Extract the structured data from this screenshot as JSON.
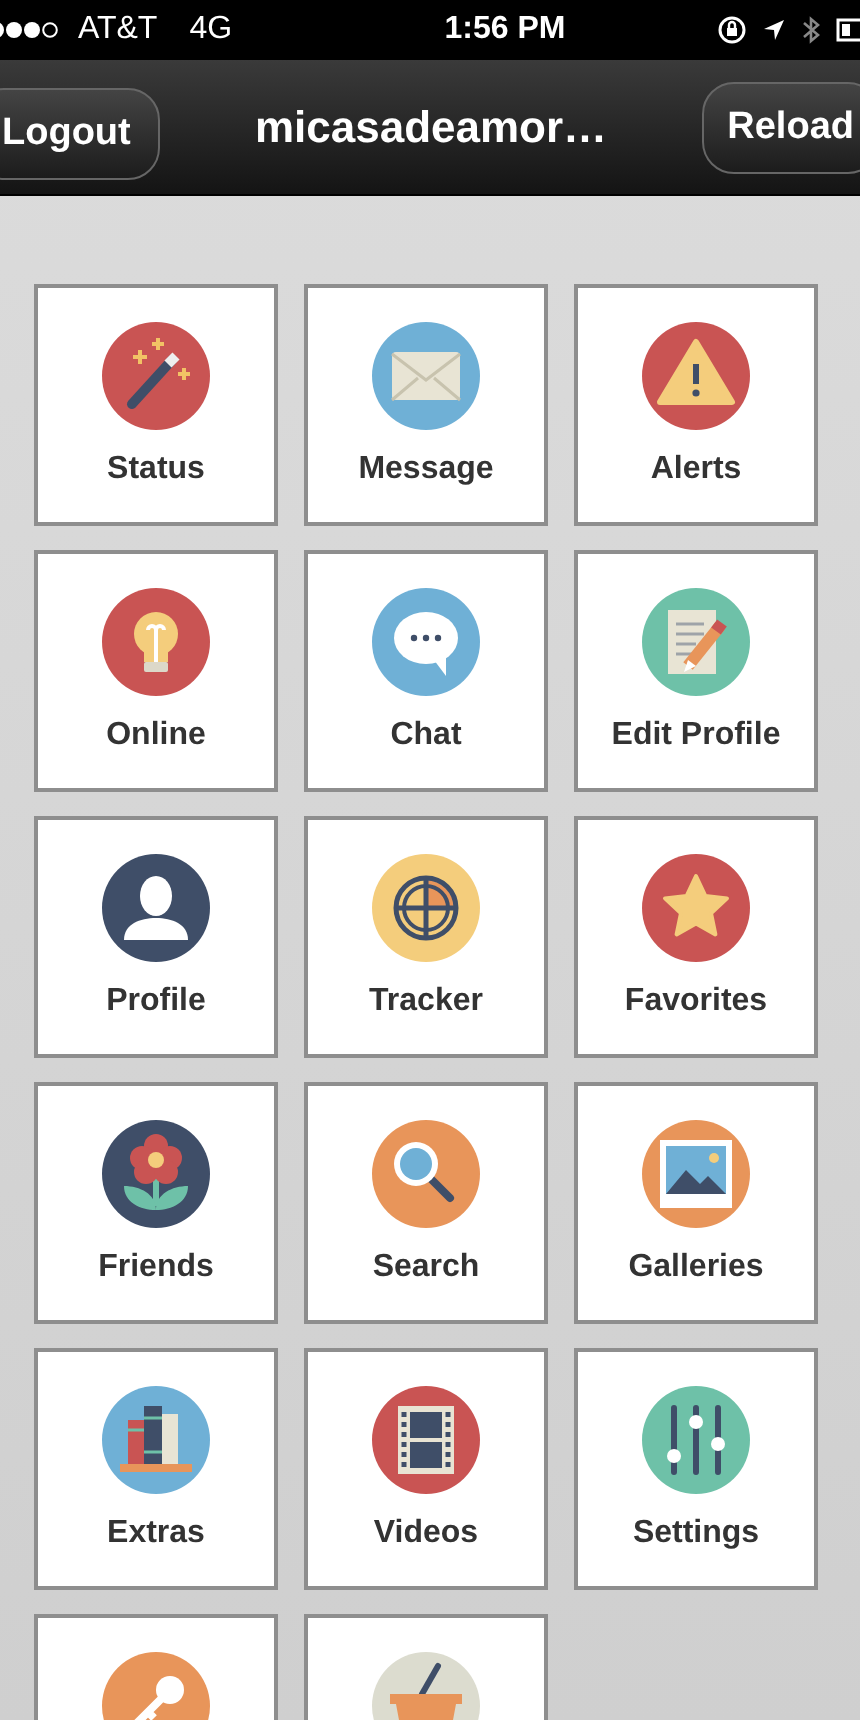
{
  "status_bar": {
    "carrier": "AT&T",
    "network": "4G",
    "time": "1:56 PM"
  },
  "nav_bar": {
    "left_button": "Logout",
    "title": "micasadeamor…",
    "right_button": "Reload"
  },
  "tiles": [
    {
      "label": "Status",
      "kind": "wand"
    },
    {
      "label": "Message",
      "kind": "envelope"
    },
    {
      "label": "Alerts",
      "kind": "warning"
    },
    {
      "label": "Online",
      "kind": "bulb"
    },
    {
      "label": "Chat",
      "kind": "chat"
    },
    {
      "label": "Edit Profile",
      "kind": "edit"
    },
    {
      "label": "Profile",
      "kind": "person"
    },
    {
      "label": "Tracker",
      "kind": "tracker"
    },
    {
      "label": "Favorites",
      "kind": "star"
    },
    {
      "label": "Friends",
      "kind": "flower"
    },
    {
      "label": "Search",
      "kind": "search"
    },
    {
      "label": "Galleries",
      "kind": "gallery"
    },
    {
      "label": "Extras",
      "kind": "books"
    },
    {
      "label": "Videos",
      "kind": "film"
    },
    {
      "label": "Settings",
      "kind": "sliders"
    },
    {
      "kind": "key"
    },
    {
      "kind": "basket"
    }
  ]
}
